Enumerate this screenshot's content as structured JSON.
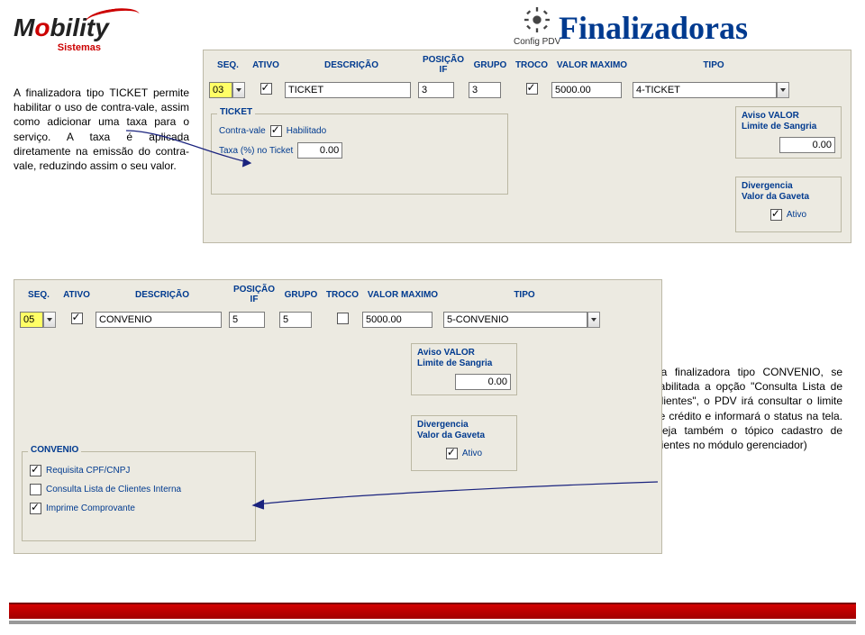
{
  "logo": {
    "text": "Mobility",
    "sub": "Sistemas"
  },
  "config_label": "Config PDV",
  "page_title": "Finalizadoras",
  "desc1": "A finalizadora tipo TICKET permite habilitar o uso de contra-vale, assim como adicionar uma taxa para o serviço. A taxa é aplicada diretamente na emissão do contra-vale, reduzindo assim o seu valor.",
  "desc2": "Na finalizadora tipo CONVENIO, se habilitada a opção \"Consulta Lista de Clientes\", o PDV irá consultar o limite de crédito e informará o status na tela. (veja também o tópico cadastro de clientes no módulo gerenciador)",
  "headers": {
    "seq": "SEQ.",
    "ativo": "ATIVO",
    "descricao": "DESCRIÇÃO",
    "posicao_if": "POSIÇÃO IF",
    "grupo": "GRUPO",
    "troco": "TROCO",
    "valor_max": "VALOR MAXIMO",
    "tipo": "TIPO"
  },
  "row1": {
    "seq": "03",
    "ativo": true,
    "descricao": "TICKET",
    "posicao_if": "3",
    "grupo": "3",
    "troco": true,
    "valor_max": "5000.00",
    "tipo": "4-TICKET"
  },
  "ticket_group": {
    "label": "TICKET",
    "contra_vale_label": "Contra-vale",
    "habilitado_label": "Habilitado",
    "habilitado": true,
    "taxa_label": "Taxa (%) no Ticket",
    "taxa_val": "0.00"
  },
  "aviso1": {
    "title1": "Aviso VALOR",
    "title2": "Limite de Sangria",
    "value": "0.00"
  },
  "diverg1": {
    "title1": "Divergencia",
    "title2": "Valor da Gaveta",
    "ativo_label": "Ativo",
    "ativo": true
  },
  "row2": {
    "seq": "05",
    "ativo": true,
    "descricao": "CONVENIO",
    "posicao_if": "5",
    "grupo": "5",
    "troco": false,
    "valor_max": "5000.00",
    "tipo": "5-CONVENIO"
  },
  "aviso2": {
    "title1": "Aviso VALOR",
    "title2": "Limite de Sangria",
    "value": "0.00"
  },
  "diverg2": {
    "title1": "Divergencia",
    "title2": "Valor da Gaveta",
    "ativo_label": "Ativo",
    "ativo": true
  },
  "convenio_group": {
    "label": "CONVENIO",
    "req_label": "Requisita CPF/CNPJ",
    "req": true,
    "consulta_label": "Consulta Lista de Clientes Interna",
    "consulta": false,
    "imprime_label": "Imprime Comprovante",
    "imprime": true
  }
}
